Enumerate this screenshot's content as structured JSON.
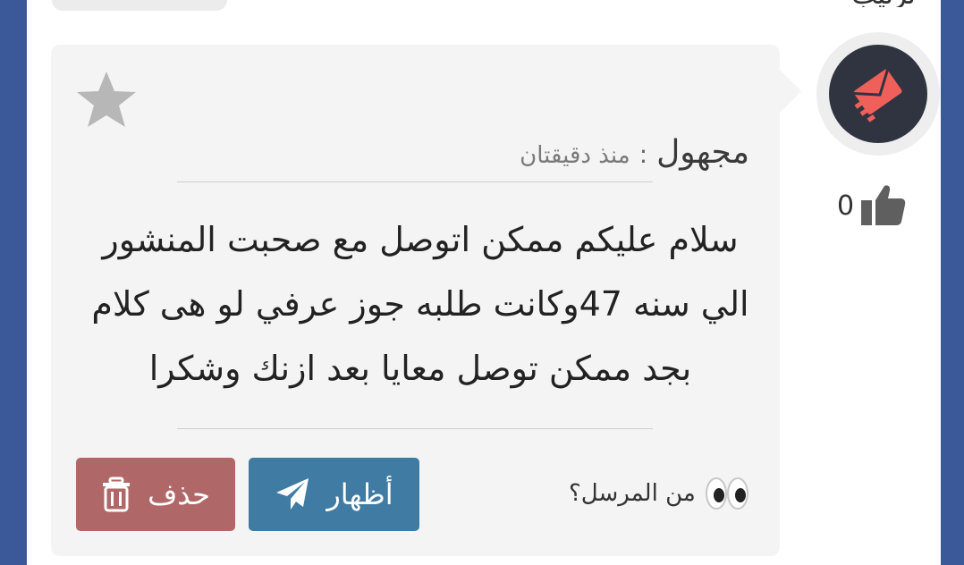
{
  "top_fragment": "ترتيب",
  "post": {
    "author": "مجهول",
    "separator": ":",
    "time": "منذ دقيقتان",
    "message": "سلام عليكم ممكن اتوصل مع صحبت المنشور الي سنه 47وكانت طلبه جوز عرفي لو هى كلام بجد ممكن توصل معايا بعد ازنك وشكرا",
    "likes": "0"
  },
  "actions": {
    "sender_question": "من المرسل؟",
    "reveal_label": "أظهار",
    "delete_label": "حذف"
  },
  "icons": {
    "avatar": "envelope-send-icon",
    "like": "thumbs-up-icon",
    "favorite": "star-icon",
    "eyes": "eyes-icon",
    "reveal": "paper-plane-icon",
    "delete": "trash-icon"
  },
  "colors": {
    "page_background": "#3b5998",
    "card_background": "#f4f4f4",
    "avatar_background": "#2f3440",
    "avatar_envelope": "#f0605a",
    "reveal_button": "#3f7ba3",
    "delete_button": "#b06767",
    "star": "#b7b7b7"
  }
}
